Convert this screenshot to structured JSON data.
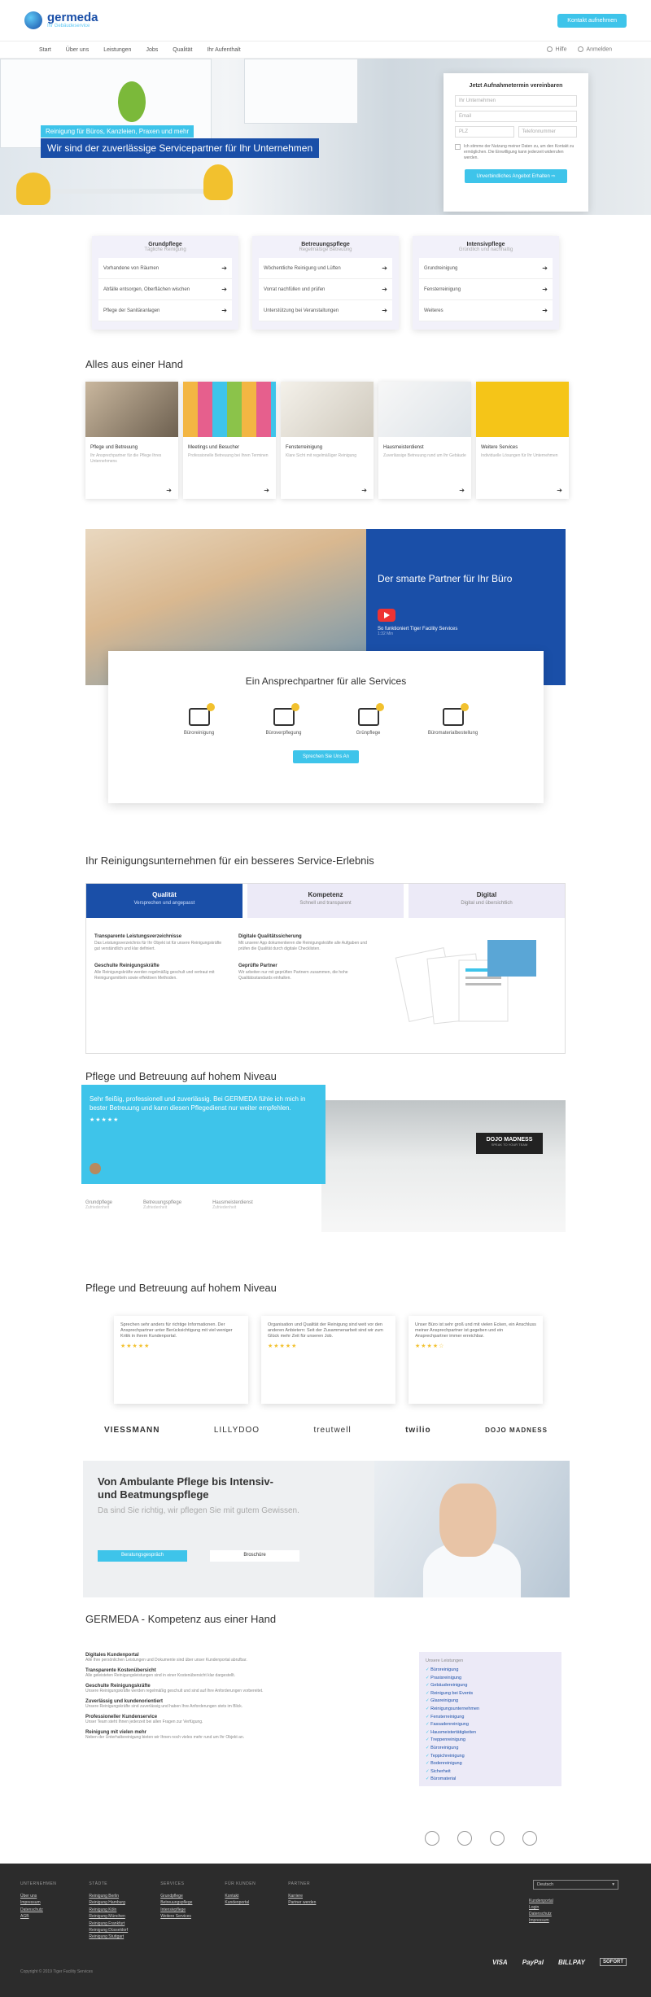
{
  "header": {
    "logo_text": "germeda",
    "logo_sub": "Ihr Gebäudeservice",
    "cta": "Kontakt aufnehmen"
  },
  "nav": {
    "items": [
      "Start",
      "Über uns",
      "Leistungen",
      "Jobs",
      "Qualität",
      "Ihr Aufenthalt"
    ],
    "right": [
      "Hilfe",
      "Anmelden"
    ]
  },
  "hero": {
    "badge": "Reinigung für Büros, Kanzleien, Praxen und mehr",
    "title": "Wir sind der zuverlässige Servicepartner für Ihr Unternehmen",
    "form": {
      "title": "Jetzt Aufnahmetermin vereinbaren",
      "fields": [
        "Ihr Unternehmen",
        "Email",
        "PLZ",
        "Telefonnummer"
      ],
      "consent": "Ich stimme der Nutzung meiner Daten zu, um den Kontakt zu ermöglichen. Die Einwilligung kann jederzeit widerrufen werden.",
      "button": "Unverbindliches Angebot Erhalten ⇨"
    }
  },
  "services": [
    {
      "title": "Grundpflege",
      "sub": "Tägliche Reinigung",
      "items": [
        "Vorhandene von Räumen",
        "Abfälle entsorgen, Oberflächen wischen",
        "Pflege der Sanitäranlagen"
      ]
    },
    {
      "title": "Betreuungspflege",
      "sub": "Regelmäßige Betreuung",
      "items": [
        "Wöchentliche Reinigung und Lüften",
        "Vorrat nachfüllen und prüfen",
        "Unterstützung bei Veranstaltungen"
      ]
    },
    {
      "title": "Intensivpflege",
      "sub": "Gründlich und nachhaltig",
      "items": [
        "Grundreinigung",
        "Fensterreinigung",
        "Weiteres"
      ]
    }
  ],
  "hand": {
    "title": "Alles aus einer Hand",
    "cards": [
      {
        "title": "Pflege und Betreuung",
        "text": "Ihr Ansprechpartner für die Pflege Ihres Unternehmens"
      },
      {
        "title": "Meetings und Besucher",
        "text": "Professionelle Betreuung bei Ihren Terminen"
      },
      {
        "title": "Fensterreinigung",
        "text": "Klare Sicht mit regelmäßiger Reinigung"
      },
      {
        "title": "Hausmeisterdienst",
        "text": "Zuverlässige Betreuung rund um Ihr Gebäude"
      },
      {
        "title": "Weitere Services",
        "text": "Individuelle Lösungen für Ihr Unternehmen"
      }
    ]
  },
  "partner": {
    "title": "Der smarte Partner für Ihr Büro",
    "video_title": "So funktioniert Tiger Facility Services",
    "video_sub": "1:32 Min"
  },
  "contact": {
    "title": "Ein Ansprechpartner für alle Services",
    "items": [
      "Büroreinigung",
      "Büroverpflegung",
      "Grünpflege",
      "Büromaterialbestellung"
    ],
    "button": "Sprechen Sie Uns An"
  },
  "quality": {
    "title": "Ihr Reinigungsunternehmen für ein besseres Service-Erlebnis",
    "tabs": [
      {
        "title": "Qualität",
        "sub": "Versprechen und angepasst"
      },
      {
        "title": "Kompetenz",
        "sub": "Schnell und transparent"
      },
      {
        "title": "Digital",
        "sub": "Digital und übersichtlich"
      }
    ],
    "features": [
      {
        "title": "Transparente Leistungsverzeichnisse",
        "text": "Das Leistungsverzeichnis für Ihr Objekt ist für unsere Reinigungskräfte gut verständlich und klar definiert."
      },
      {
        "title": "Digitale Qualitätssicherung",
        "text": "Mit unserer App dokumentieren die Reinigungskräfte alle Aufgaben und prüfen die Qualität durch digitale Checklisten."
      },
      {
        "title": "Geschulte Reinigungskräfte",
        "text": "Alle Reinigungskräfte werden regelmäßig geschult und vertraut mit Reinigungsmitteln sowie effektiven Methoden."
      },
      {
        "title": "Geprüfte Partner",
        "text": "Wir arbeiten nur mit geprüften Partnern zusammen, die hohe Qualitätsstandards einhalten."
      }
    ]
  },
  "pflege": {
    "title": "Pflege und Betreuung auf hohem Niveau",
    "quote": "Sehr fleißig, professionell und zuverlässig. Bei GERMEDA fühle ich mich in bester Betreuung und kann diesen Pflegedienst nur weiter empfehlen.",
    "stars": "★★★★★",
    "sign": "DOJO MADNESS",
    "sign_sub": "SPEAK TO YOUR TEAM",
    "stats": [
      {
        "label": "Grundpflege",
        "sub": "Zufriedenheit"
      },
      {
        "label": "Betreuungspflege",
        "sub": "Zufriedenheit"
      },
      {
        "label": "Hausmeisterdienst",
        "sub": "Zufriedenheit"
      }
    ]
  },
  "reviews": {
    "title": "Pflege und Betreuung auf hohem Niveau",
    "items": [
      {
        "text": "Sprechen sehr anders für richtige Informationen. Der Ansprechpartner unter Berücksichtigung mit viel weniger Kritik in ihrem Kundenportal.",
        "stars": "★★★★★"
      },
      {
        "text": "Organisation und Qualität der Reinigung sind weit vor den anderen Anbietern: Seit der Zusammenarbeit sind wir zum Glück mehr Zeit für unseren Job.",
        "stars": "★★★★★"
      },
      {
        "text": "Unser Büro ist sehr groß und mit vielen Ecken, ein Anschluss meiner Ansprechpartner ist gegeben und ein Ansprechpartner immer erreichbar.",
        "stars": "★★★★☆"
      }
    ]
  },
  "logos": [
    "VIESSMANN",
    "LILLYDOO",
    "treutwell",
    "twilio",
    "DOJO MADNESS"
  ],
  "banner": {
    "title": "Von Ambulante Pflege bis Intensiv- und Beatmungspflege",
    "subtitle": "Da sind Sie richtig, wir pflegen Sie mit gutem Gewissen.",
    "btn1": "Beratungsgespräch",
    "btn2": "Broschüre"
  },
  "kompetenz": {
    "title": "GERMEDA - Kompetenz aus einer Hand",
    "sections": [
      {
        "title": "Digitales Kundenportal",
        "text": "Alle Ihre persönlichen Leistungen und Dokumente sind über unser Kundenportal abrufbar."
      },
      {
        "title": "Transparente Kostenübersicht",
        "text": "Alle geleisteten Reinigungsleistungen sind in einer Kostenübersicht klar dargestellt."
      },
      {
        "title": "Geschulte Reinigungskräfte",
        "text": "Unsere Reinigungskräfte werden regelmäßig geschult und sind auf Ihre Anforderungen vorbereitet."
      },
      {
        "title": "Zuverlässig und kundenorientiert",
        "text": "Unsere Reinigungskräfte sind zuverlässig und haben Ihre Anforderungen stets im Blick."
      },
      {
        "title": "Professioneller Kundenservice",
        "text": "Unser Team steht Ihnen jederzeit bei allen Fragen zur Verfügung."
      },
      {
        "title": "Reinigung mit vielen mehr",
        "text": "Neben der Unterhaltsreinigung bieten wir Ihnen noch vieles mehr rund um Ihr Objekt an."
      }
    ],
    "list_title": "Unsere Leistungen",
    "list": [
      "Büroreinigung",
      "Praxisreinigung",
      "Gebäudereinigung",
      "Reinigung bei Events",
      "Glasreinigung",
      "Reinigungsunternehmen",
      "Fensterreinigung",
      "Fassadenreinigung",
      "Hausmeistertätigkeiten",
      "Treppenreinigung",
      "Büroreinigung",
      "Teppichreinigung",
      "Bodenreinigung",
      "Sicherheit",
      "Büromaterial"
    ]
  },
  "footer": {
    "cols": [
      {
        "title": "UNTERNEHMEN",
        "links": [
          "Über uns",
          "Impressum",
          "Datenschutz",
          "AGB"
        ]
      },
      {
        "title": "STÄDTE",
        "links": [
          "Reinigung Berlin",
          "Reinigung Hamburg",
          "Reinigung Köln",
          "Reinigung München",
          "Reinigung Frankfurt",
          "Reinigung Düsseldorf",
          "Reinigung Stuttgart"
        ]
      },
      {
        "title": "SERVICES",
        "links": [
          "Grundpflege",
          "Betreuungspflege",
          "Intensivpflege",
          "Weitere Services"
        ]
      },
      {
        "title": "FÜR KUNDEN",
        "links": [
          "Kontakt",
          "Kundenportal"
        ]
      },
      {
        "title": "PARTNER",
        "links": [
          "Karriere",
          "Partner werden"
        ]
      }
    ],
    "lang": "Deutsch",
    "extra_links": [
      "Kundenportal",
      "Login",
      "Datenschutz",
      "Impressum"
    ],
    "copyright": "Copyright © 2019 Tiger Facility Services",
    "payments": [
      "VISA",
      "PayPal",
      "BILLPAY",
      "SOFORT"
    ]
  }
}
